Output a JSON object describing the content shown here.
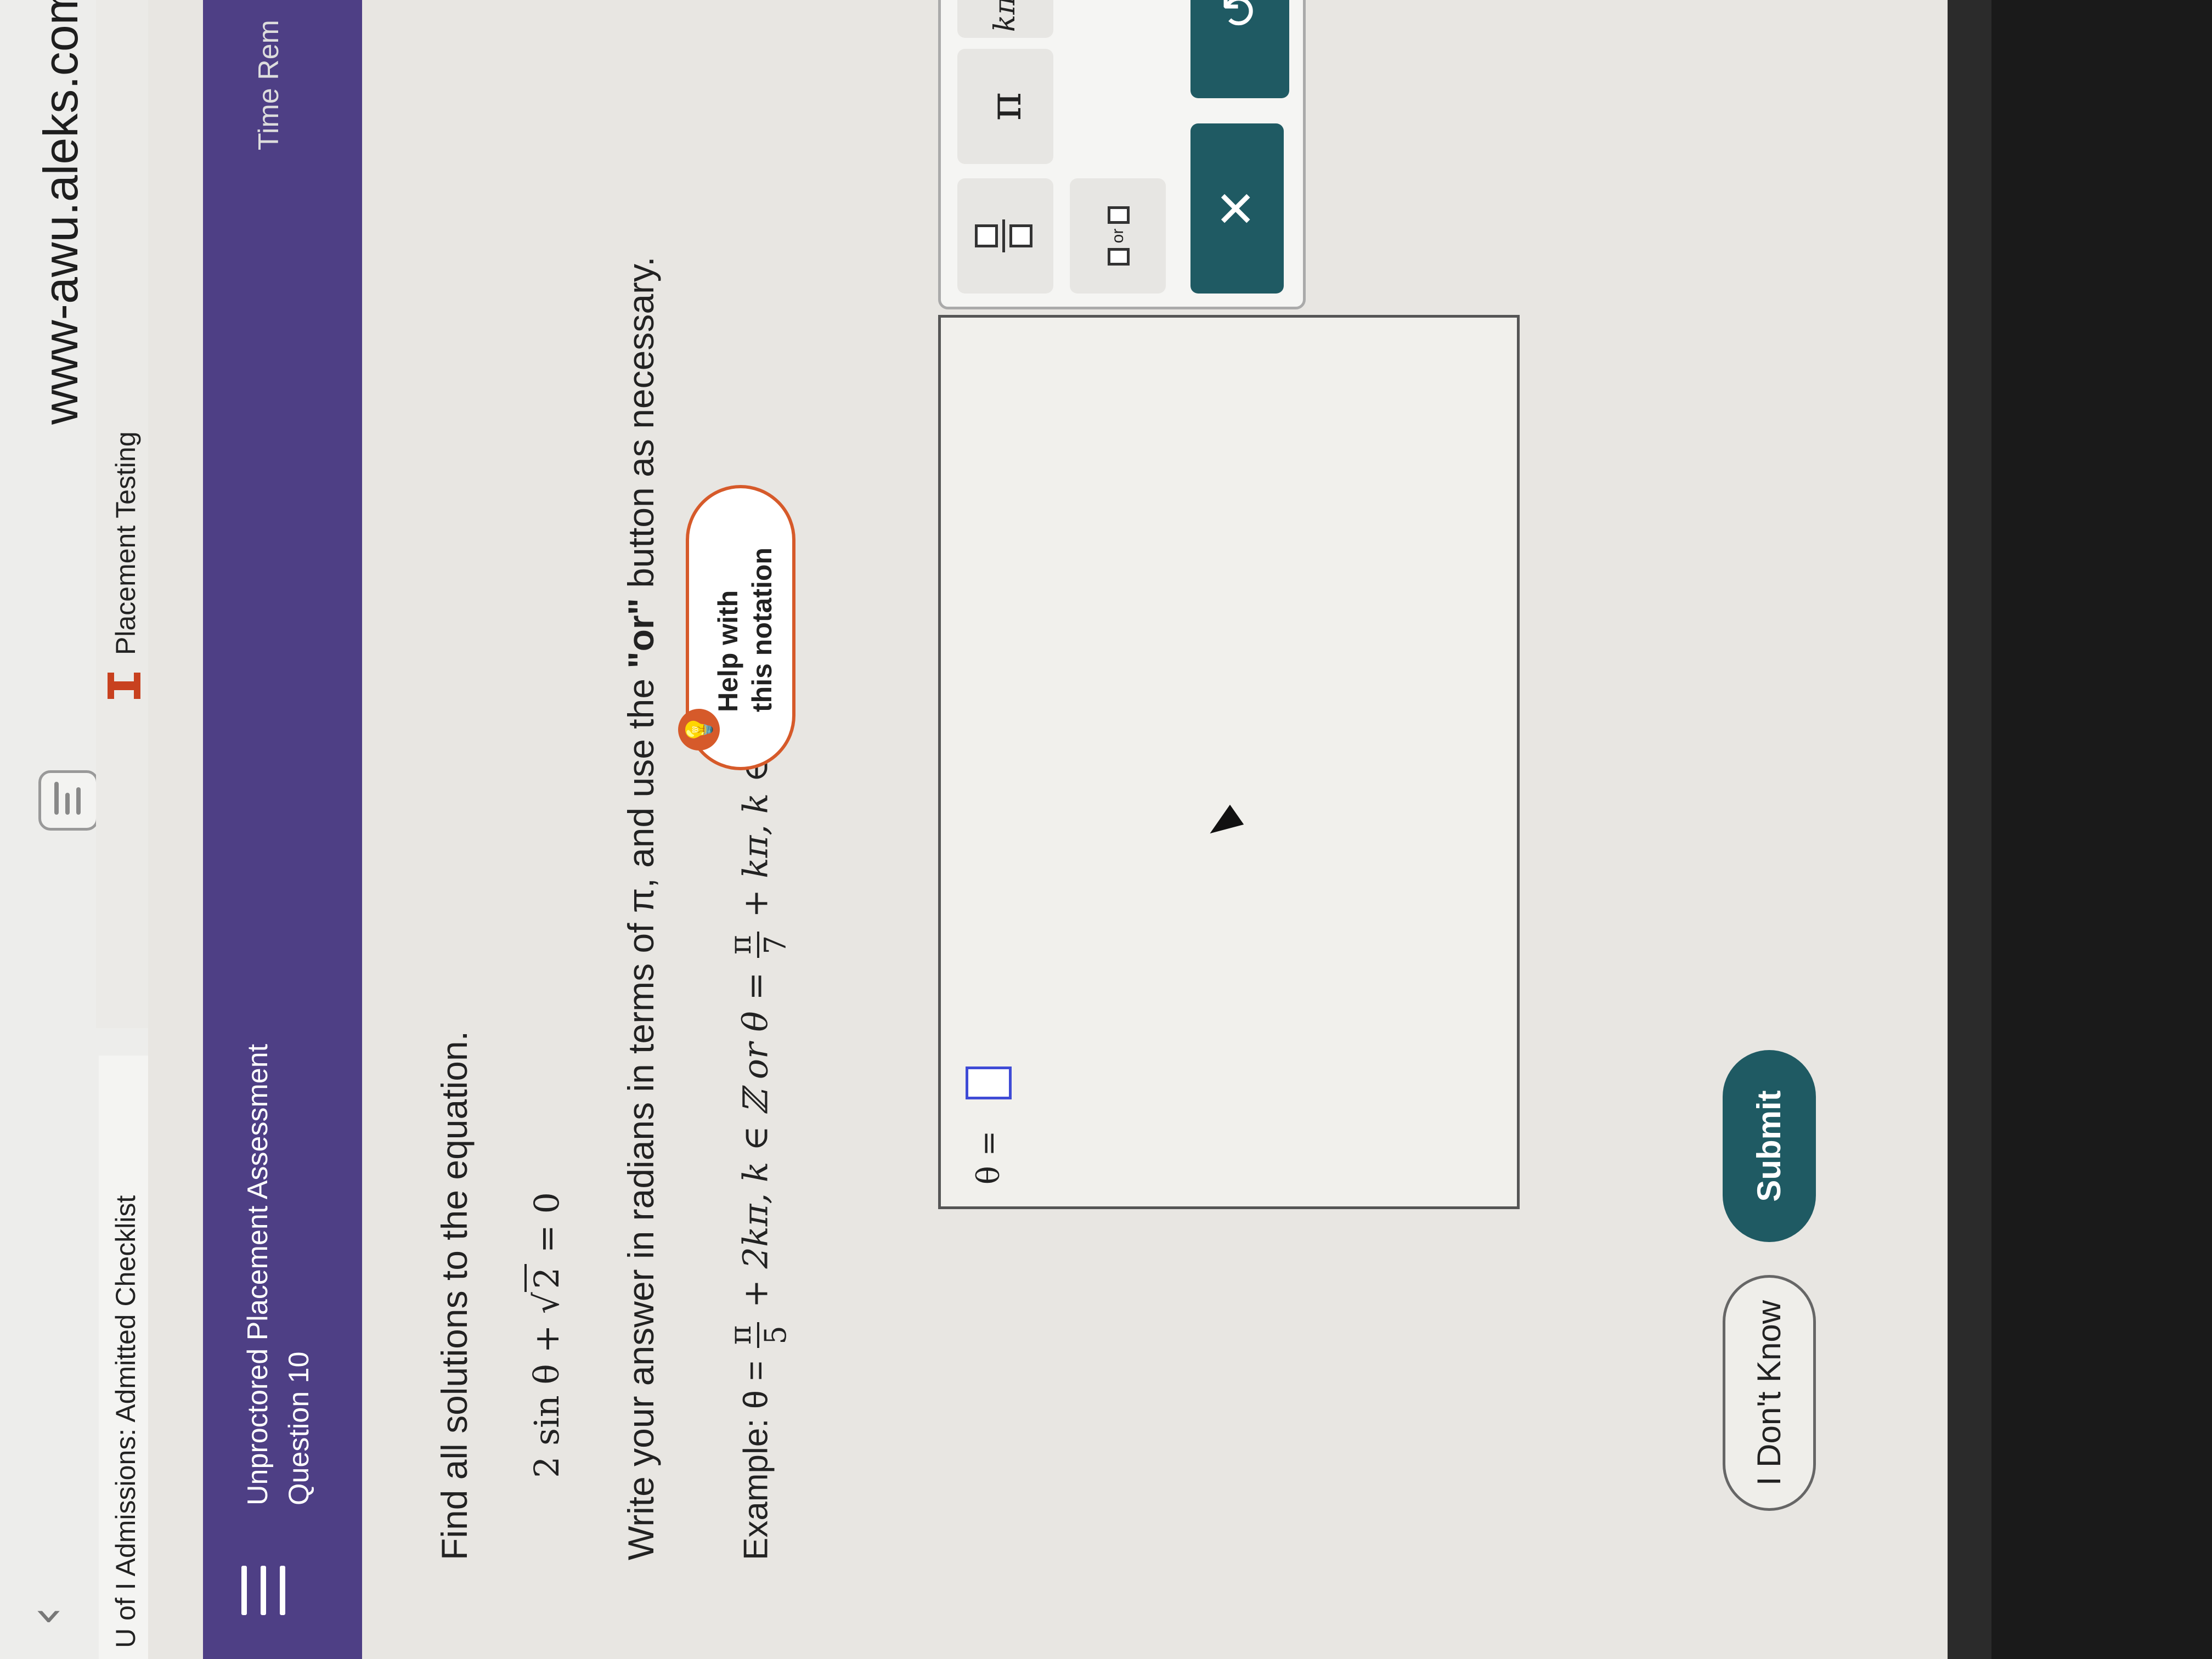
{
  "browser": {
    "url": "www-awu.aleks.com",
    "tab_left": "U of I Admissions: Admitted Checklist",
    "tab_right": "Placement Testing"
  },
  "header": {
    "title": "Unproctored Placement Assessment",
    "question": "Question 10",
    "time_label": "Time Rem"
  },
  "question": {
    "prompt": "Find all solutions to the equation.",
    "equation_left": "2 sin θ + ",
    "equation_sqrt": "2",
    "equation_right": " = 0",
    "instruction_pre": "Write your answer in radians in terms of π, and use the ",
    "instruction_bold": "\"or\"",
    "instruction_post": " button as necessary.",
    "example_label": "Example: θ = ",
    "example_frac1_num": "π",
    "example_frac1_den": "5",
    "example_mid": " + 2kπ, k ∈ ℤ or θ = ",
    "example_frac2_num": "π",
    "example_frac2_den": "7",
    "example_end": " + kπ, k ∈ ℤ"
  },
  "help": {
    "line1": "Help with",
    "line2": "this notation"
  },
  "answer": {
    "theta_label": "θ ="
  },
  "keypad": {
    "pi": "π",
    "k_in_z": "kπ,k∈Z",
    "or_label": "or",
    "clear": "✕",
    "undo": "↺"
  },
  "footer": {
    "dont_know": "I Don't Know",
    "submit": "Submit"
  },
  "colors": {
    "header_purple": "#4e3f85",
    "teal_button": "#1f5a63",
    "help_orange": "#d65a2a",
    "input_blue": "#3f4bd6"
  }
}
